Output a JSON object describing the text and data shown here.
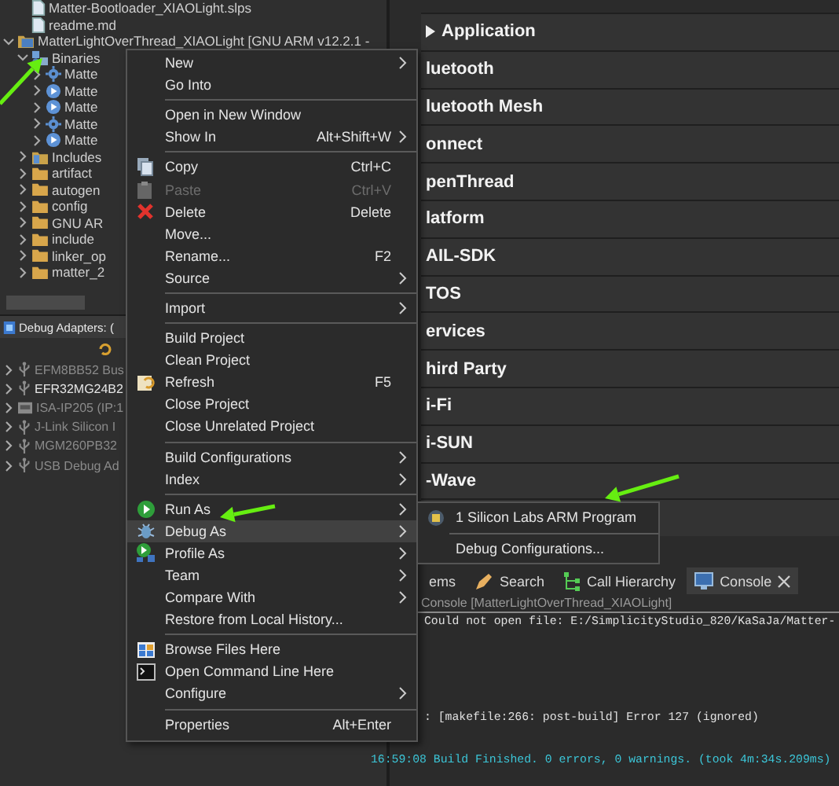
{
  "project_explorer": {
    "items": [
      {
        "label": "Matter-Bootloader_XIAOLight.slps",
        "kind": "file"
      },
      {
        "label": "readme.md",
        "kind": "file"
      },
      {
        "label": "MatterLightOverThread_XIAOLight [GNU ARM v12.2.1 -",
        "kind": "project",
        "expanded": true,
        "children": [
          {
            "label": "Binaries",
            "kind": "binaries",
            "expanded": true,
            "children": [
              {
                "label": "Matte",
                "kind": "binary",
                "expanded": false
              },
              {
                "label": "Matte",
                "kind": "exec",
                "expanded": false
              },
              {
                "label": "Matte",
                "kind": "exec",
                "expanded": false
              },
              {
                "label": "Matte",
                "kind": "binary",
                "expanded": false
              },
              {
                "label": "Matte",
                "kind": "exec",
                "expanded": false
              }
            ]
          },
          {
            "label": "Includes",
            "kind": "includes",
            "expanded": false
          },
          {
            "label": "artifact",
            "kind": "folder",
            "expanded": false
          },
          {
            "label": "autogen",
            "kind": "folder",
            "expanded": false
          },
          {
            "label": "config",
            "kind": "folder",
            "expanded": false
          },
          {
            "label": "GNU AR",
            "kind": "folder",
            "expanded": false
          },
          {
            "label": "include",
            "kind": "folder",
            "expanded": false
          },
          {
            "label": "linker_op",
            "kind": "folder",
            "expanded": false
          },
          {
            "label": "matter_2",
            "kind": "folder",
            "expanded": false
          }
        ]
      }
    ]
  },
  "debug_adapters": {
    "title": "Debug Adapters: (",
    "items": [
      {
        "label": "EFM8BB52 Bus",
        "kind": "usb",
        "connected": false
      },
      {
        "label": "EFR32MG24B2",
        "kind": "usb",
        "connected": true
      },
      {
        "label": "ISA-IP205 (IP:1",
        "kind": "network",
        "connected": false
      },
      {
        "label": "J-Link Silicon I",
        "kind": "usb",
        "connected": false
      },
      {
        "label": "MGM260PB32",
        "kind": "usb",
        "connected": false
      },
      {
        "label": "USB Debug Ad",
        "kind": "usb",
        "connected": false
      }
    ]
  },
  "categories": [
    {
      "label": "Application",
      "kind": "collapsed"
    },
    {
      "label": "luetooth",
      "kind": "row"
    },
    {
      "label": "luetooth Mesh",
      "kind": "row"
    },
    {
      "label": "onnect",
      "kind": "row"
    },
    {
      "label": "penThread",
      "kind": "row"
    },
    {
      "label": "latform",
      "kind": "row"
    },
    {
      "label": "AIL-SDK",
      "kind": "row"
    },
    {
      "label": "TOS",
      "kind": "row"
    },
    {
      "label": "ervices",
      "kind": "row"
    },
    {
      "label": "hird Party",
      "kind": "row"
    },
    {
      "label": "i-Fi",
      "kind": "row"
    },
    {
      "label": "i-SUN",
      "kind": "row"
    },
    {
      "label": "-Wave",
      "kind": "row"
    }
  ],
  "bottom_tabs": [
    {
      "label": "ems",
      "kind": "plain",
      "selected": false
    },
    {
      "label": "Search",
      "kind": "search",
      "selected": false
    },
    {
      "label": "Call Hierarchy",
      "kind": "hierarchy",
      "selected": false
    },
    {
      "label": "Console",
      "kind": "console",
      "selected": true
    }
  ],
  "console": {
    "title": "Console [MatterLightOverThread_XIAOLight]",
    "lines": [
      {
        "text": "Could not open file: E:/SimplicityStudio_820/KaSaJa/Matter-",
        "kind": "output"
      },
      {
        "text": ": [makefile:266: post-build] Error 127 (ignored)",
        "kind": "output"
      },
      {
        "text": "16:59:08 Build Finished. 0 errors, 0 warnings. (took 4m:34s.209ms)",
        "kind": "finished"
      }
    ]
  },
  "context_menu": {
    "items": [
      {
        "kind": "item",
        "label": "New",
        "submenu": true,
        "disabled": false,
        "selected": false
      },
      {
        "kind": "item",
        "label": "Go Into",
        "submenu": false,
        "disabled": false,
        "selected": false
      },
      {
        "kind": "separator"
      },
      {
        "kind": "item",
        "label": "Open in New Window",
        "submenu": false,
        "disabled": false,
        "selected": false
      },
      {
        "kind": "item",
        "label": "Show In",
        "shortcut": "Alt+Shift+W",
        "submenu": true,
        "disabled": false,
        "selected": false
      },
      {
        "kind": "separator"
      },
      {
        "kind": "copy",
        "label": "Copy",
        "shortcut": "Ctrl+C",
        "submenu": false,
        "disabled": false,
        "selected": false
      },
      {
        "kind": "paste",
        "label": "Paste",
        "shortcut": "Ctrl+V",
        "submenu": false,
        "disabled": true,
        "selected": false
      },
      {
        "kind": "delete",
        "label": "Delete",
        "shortcut": "Delete",
        "submenu": false,
        "disabled": false,
        "selected": false
      },
      {
        "kind": "item",
        "label": "Move...",
        "submenu": false,
        "disabled": false,
        "selected": false
      },
      {
        "kind": "item",
        "label": "Rename...",
        "shortcut": "F2",
        "submenu": false,
        "disabled": false,
        "selected": false
      },
      {
        "kind": "item",
        "label": "Source",
        "submenu": true,
        "disabled": false,
        "selected": false
      },
      {
        "kind": "separator"
      },
      {
        "kind": "item",
        "label": "Import",
        "submenu": true,
        "disabled": false,
        "selected": false
      },
      {
        "kind": "separator"
      },
      {
        "kind": "item",
        "label": "Build Project",
        "submenu": false,
        "disabled": false,
        "selected": false
      },
      {
        "kind": "item",
        "label": "Clean Project",
        "submenu": false,
        "disabled": false,
        "selected": false
      },
      {
        "kind": "refresh",
        "label": "Refresh",
        "shortcut": "F5",
        "submenu": false,
        "disabled": false,
        "selected": false
      },
      {
        "kind": "item",
        "label": "Close Project",
        "submenu": false,
        "disabled": false,
        "selected": false
      },
      {
        "kind": "item",
        "label": "Close Unrelated Project",
        "submenu": false,
        "disabled": false,
        "selected": false
      },
      {
        "kind": "separator"
      },
      {
        "kind": "item",
        "label": "Build Configurations",
        "submenu": true,
        "disabled": false,
        "selected": false
      },
      {
        "kind": "item",
        "label": "Index",
        "submenu": true,
        "disabled": false,
        "selected": false
      },
      {
        "kind": "separator"
      },
      {
        "kind": "run",
        "label": "Run As",
        "submenu": true,
        "disabled": false,
        "selected": false
      },
      {
        "kind": "debug",
        "label": "Debug As",
        "submenu": true,
        "disabled": false,
        "selected": true
      },
      {
        "kind": "profile",
        "label": "Profile As",
        "submenu": true,
        "disabled": false,
        "selected": false
      },
      {
        "kind": "item",
        "label": "Team",
        "submenu": true,
        "disabled": false,
        "selected": false
      },
      {
        "kind": "item",
        "label": "Compare With",
        "submenu": true,
        "disabled": false,
        "selected": false
      },
      {
        "kind": "item",
        "label": "Restore from Local History...",
        "submenu": false,
        "disabled": false,
        "selected": false
      },
      {
        "kind": "separator"
      },
      {
        "kind": "browse",
        "label": "Browse Files Here",
        "submenu": false,
        "disabled": false,
        "selected": false
      },
      {
        "kind": "terminal",
        "label": "Open Command Line Here",
        "submenu": false,
        "disabled": false,
        "selected": false
      },
      {
        "kind": "item",
        "label": "Configure",
        "submenu": true,
        "disabled": false,
        "selected": false
      },
      {
        "kind": "separator"
      },
      {
        "kind": "item",
        "label": "Properties",
        "shortcut": "Alt+Enter",
        "submenu": false,
        "disabled": false,
        "selected": false
      }
    ]
  },
  "submenu": {
    "items": [
      {
        "kind": "chip",
        "label": "1 Silicon Labs ARM Program"
      },
      {
        "kind": "separator"
      },
      {
        "kind": "item",
        "label": "Debug Configurations..."
      }
    ]
  }
}
